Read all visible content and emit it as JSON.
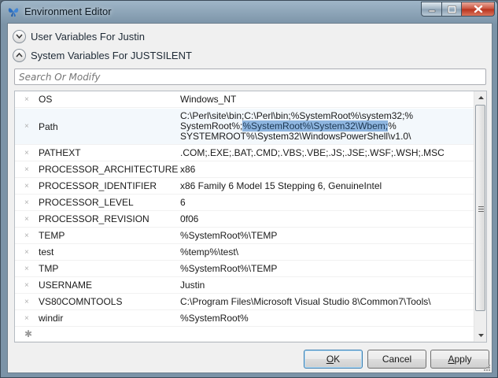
{
  "window": {
    "title": "Environment Editor"
  },
  "sections": {
    "user": "User Variables For Justin",
    "system": "System Variables For JUSTSILENT"
  },
  "search": {
    "placeholder": "Search Or Modify"
  },
  "variables": [
    {
      "name": "OS",
      "value": "Windows_NT"
    },
    {
      "name": "Path",
      "value_lines": [
        "C:\\Perl\\site\\bin;C:\\Perl\\bin;%SystemRoot%\\system32;%",
        "SystemRoot%;",
        "%SystemRoot%\\System32\\Wbem;",
        "%",
        "SYSTEMROOT%\\System32\\WindowsPowerShell\\v1.0\\"
      ]
    },
    {
      "name": "PATHEXT",
      "value": ".COM;.EXE;.BAT;.CMD;.VBS;.VBE;.JS;.JSE;.WSF;.WSH;.MSC"
    },
    {
      "name": "PROCESSOR_ARCHITECTURE",
      "value": "x86"
    },
    {
      "name": "PROCESSOR_IDENTIFIER",
      "value": "x86 Family 6 Model 15 Stepping 6, GenuineIntel"
    },
    {
      "name": "PROCESSOR_LEVEL",
      "value": "6"
    },
    {
      "name": "PROCESSOR_REVISION",
      "value": "0f06"
    },
    {
      "name": "TEMP",
      "value": "%SystemRoot%\\TEMP"
    },
    {
      "name": "test",
      "value": "%temp%\\test\\"
    },
    {
      "name": "TMP",
      "value": "%SystemRoot%\\TEMP"
    },
    {
      "name": "USERNAME",
      "value": "Justin"
    },
    {
      "name": "VS80COMNTOOLS",
      "value": "C:\\Program Files\\Microsoft Visual Studio 8\\Common7\\Tools\\"
    },
    {
      "name": "windir",
      "value": "%SystemRoot%"
    }
  ],
  "delete_glyph": "×",
  "new_row_glyph": "✱",
  "buttons": {
    "ok_mnemonic": "O",
    "ok_rest": "K",
    "cancel": "Cancel",
    "apply_mnemonic": "A",
    "apply_rest": "pply"
  },
  "colors": {
    "selection_highlight": "#8fb6e0",
    "title_bar": "#9fb6c8",
    "close_button": "#c9503b"
  }
}
